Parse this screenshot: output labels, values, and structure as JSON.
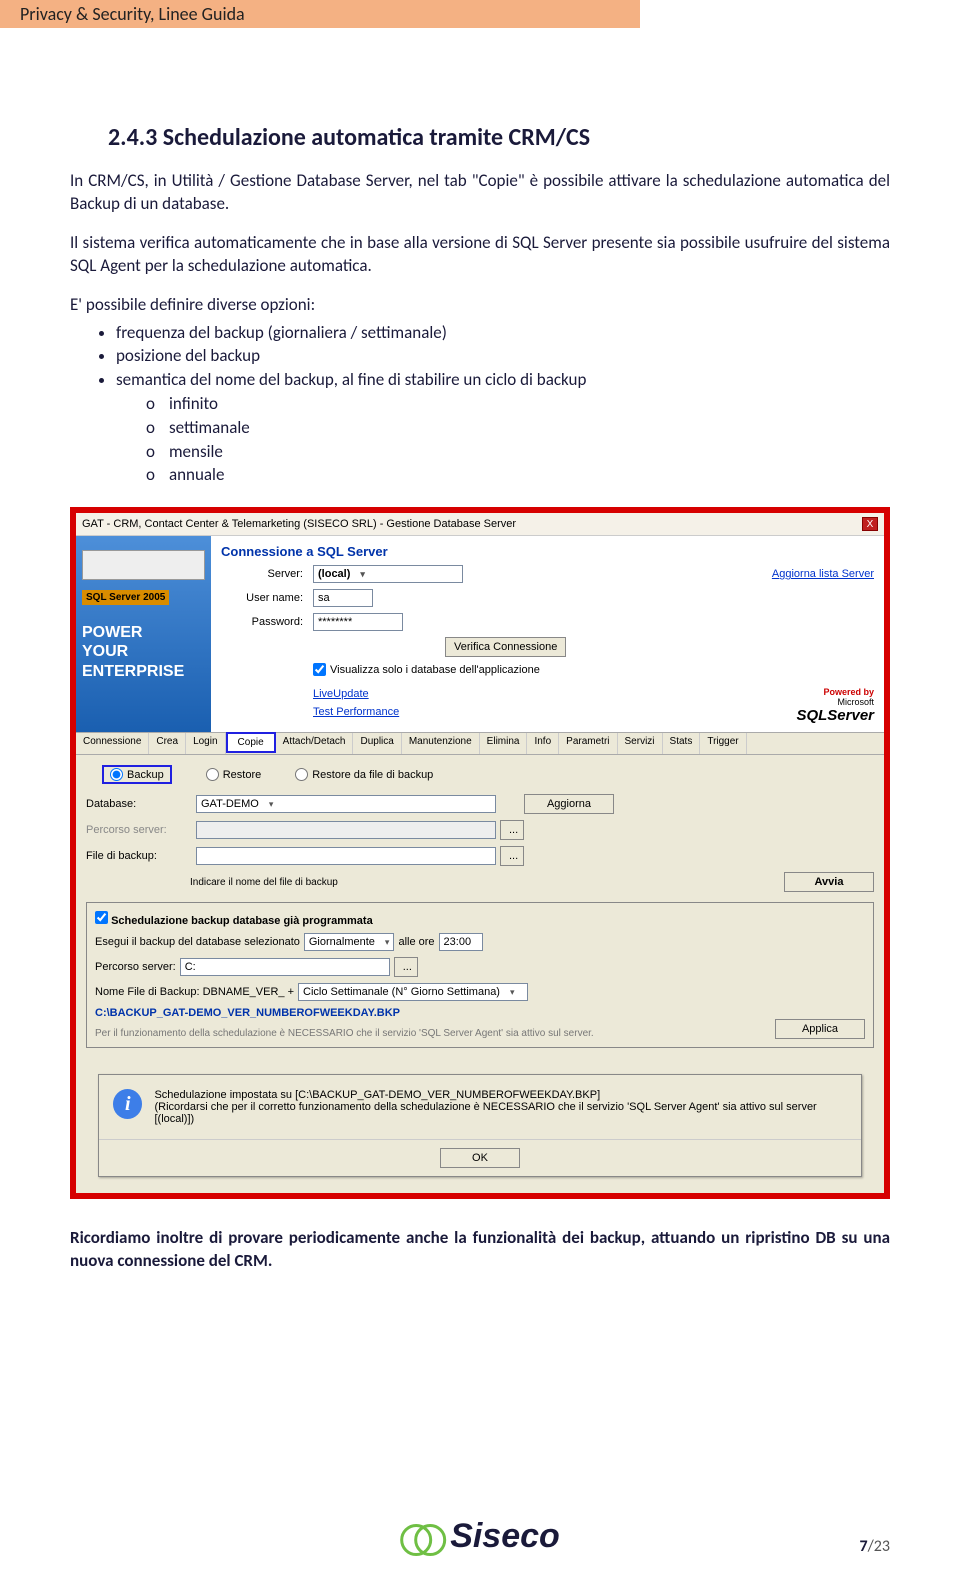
{
  "header": {
    "title": "Privacy & Security, Linee Guida"
  },
  "section": {
    "number_title": "2.4.3 Schedulazione automatica tramite CRM/CS",
    "p1": "In CRM/CS, in Utilità / Gestione Database Server, nel tab \"Copie\" è possibile attivare la schedulazione automatica del Backup di un database.",
    "p2": "Il sistema verifica automaticamente che in base alla versione di SQL Server presente sia possibile usufruire del sistema SQL Agent per la schedulazione automatica.",
    "p3": "E' possibile definire diverse opzioni:",
    "bullets": [
      "frequenza del backup (giornaliera / settimanale)",
      "posizione del backup",
      "semantica del nome del backup, al fine di stabilire un ciclo di backup"
    ],
    "subbullets": [
      "infinito",
      "settimanale",
      "mensile",
      "annuale"
    ]
  },
  "screenshot": {
    "titlebar": "GAT - CRM, Contact Center & Telemarketing (SISECO SRL) - Gestione Database Server",
    "left": {
      "badge": "SQL Server 2005",
      "power_line1": "POWER",
      "power_line2": "YOUR",
      "power_line3": "ENTERPRISE"
    },
    "conn": {
      "title": "Connessione a SQL Server",
      "server_label": "Server:",
      "server_value": "(local)",
      "aggiorna_lista": "Aggiorna lista Server",
      "user_label": "User name:",
      "user_value": "sa",
      "pass_label": "Password:",
      "pass_value": "********",
      "verify_btn": "Verifica Connessione",
      "only_app_db": "Visualizza solo i database dell'applicazione",
      "liveupdate": "LiveUpdate",
      "testperf": "Test Performance",
      "powered_by": "Powered by",
      "sqls_top": "Microsoft",
      "sqls_bottom": "SQLServer"
    },
    "tabs": [
      "Connessione",
      "Crea",
      "Login",
      "Copie",
      "Attach/Detach",
      "Duplica",
      "Manutenzione",
      "Elimina",
      "Info",
      "Parametri",
      "Servizi",
      "Stats",
      "Trigger"
    ],
    "tab_active_index": 3,
    "copies": {
      "radio_backup": "Backup",
      "radio_restore": "Restore",
      "radio_restore_file": "Restore da file di backup",
      "db_label": "Database:",
      "db_value": "GAT-DEMO",
      "aggiorna_btn": "Aggiorna",
      "server_path_label": "Percorso server:",
      "file_label": "File di backup:",
      "file_hint": "Indicare il nome del file di backup",
      "avvia_btn": "Avvia",
      "sched": {
        "chk": "Schedulazione backup database già programmata",
        "run_text_pre": "Esegui il backup del database selezionato",
        "freq_value": "Giornalmente",
        "run_text_mid": "alle ore",
        "time_value": "23:00",
        "path_label": "Percorso server:",
        "path_value": "C:",
        "name_label": "Nome File di Backup: DBNAME_VER_ +",
        "cycle_value": "Ciclo Settimanale (N° Giorno Settimana)",
        "preview": "C:\\BACKUP_GAT-DEMO_VER_NUMBEROFWEEKDAY.BKP",
        "note": "Per il funzionamento della schedulazione è NECESSARIO che il servizio 'SQL Server Agent' sia attivo sul server.",
        "applica_btn": "Applica"
      }
    },
    "dialog": {
      "line1": "Schedulazione impostata su [C:\\BACKUP_GAT-DEMO_VER_NUMBEROFWEEKDAY.BKP]",
      "line2": "(Ricordarsi che per il corretto funzionamento della schedulazione è NECESSARIO che il servizio 'SQL Server Agent' sia attivo sul server [(local)])",
      "ok": "OK"
    }
  },
  "closing": {
    "text": "Ricordiamo inoltre di provare periodicamente anche la funzionalità dei backup, attuando un ripristino DB su una nuova connessione del CRM."
  },
  "footer": {
    "logo_text": "Siseco",
    "page_current": "7",
    "page_total": "23"
  }
}
